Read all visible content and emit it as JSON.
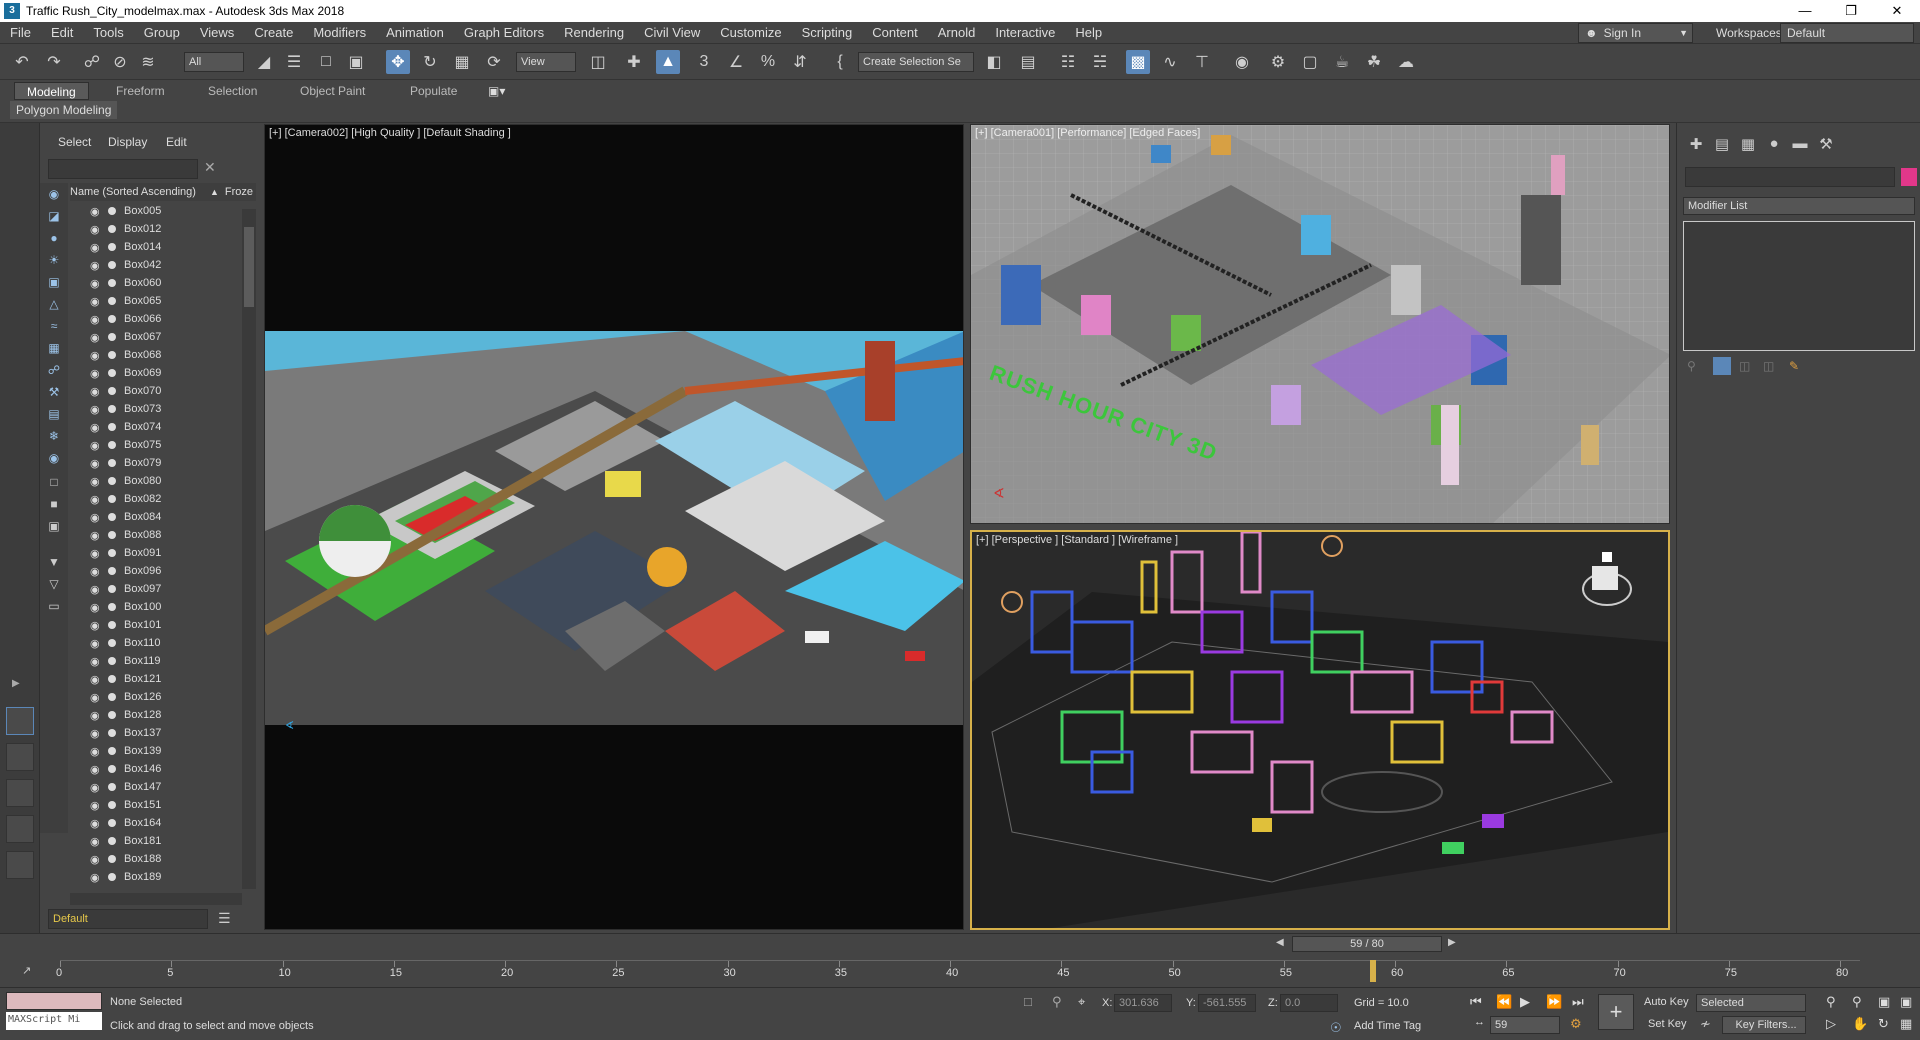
{
  "window": {
    "title": "Traffic Rush_City_modelmax.max - Autodesk 3ds Max 2018"
  },
  "menu": [
    "File",
    "Edit",
    "Tools",
    "Group",
    "Views",
    "Create",
    "Modifiers",
    "Animation",
    "Graph Editors",
    "Rendering",
    "Civil View",
    "Customize",
    "Scripting",
    "Content",
    "Arnold",
    "Interactive",
    "Help"
  ],
  "account": {
    "signin": "Sign In",
    "workspaces_label": "Workspaces:",
    "workspace": "Default"
  },
  "toolbar": {
    "filter": "All",
    "refcoord": "View",
    "selection_set": "Create Selection Se"
  },
  "ribbon": {
    "tabs": [
      "Modeling",
      "Freeform",
      "Selection",
      "Object Paint",
      "Populate"
    ],
    "active": "Modeling",
    "subtab": "Polygon Modeling"
  },
  "explorer": {
    "tabs": [
      "Select",
      "Display",
      "Edit"
    ],
    "header_name": "Name (Sorted Ascending)",
    "header_frozen": "Froze",
    "items": [
      "Box005",
      "Box012",
      "Box014",
      "Box042",
      "Box060",
      "Box065",
      "Box066",
      "Box067",
      "Box068",
      "Box069",
      "Box070",
      "Box073",
      "Box074",
      "Box075",
      "Box079",
      "Box080",
      "Box082",
      "Box084",
      "Box088",
      "Box091",
      "Box096",
      "Box097",
      "Box100",
      "Box101",
      "Box110",
      "Box119",
      "Box121",
      "Box126",
      "Box128",
      "Box137",
      "Box139",
      "Box146",
      "Box147",
      "Box151",
      "Box164",
      "Box181",
      "Box188",
      "Box189"
    ],
    "layer": "Default"
  },
  "viewports": {
    "vp1": "[+] [Camera002] [High Quality ] [Default Shading ]",
    "vp2": "[+] [Camera001] [Performance] [Edged Faces]",
    "vp3": "[+] [Perspective ] [Standard ] [Wireframe ]",
    "vp2_text": "RUSH HOUR CITY 3D"
  },
  "command_panel": {
    "modifier_list": "Modifier List"
  },
  "timeline": {
    "frame": "59 / 80",
    "ticks": [
      0,
      5,
      10,
      15,
      20,
      25,
      30,
      35,
      40,
      45,
      50,
      55,
      60,
      65,
      70,
      75,
      80
    ],
    "current": 59,
    "total": 80
  },
  "status": {
    "maxscript": "MAXScript Mi",
    "selection": "None Selected",
    "prompt": "Click and drag to select and move objects",
    "x_label": "X:",
    "x": "301.636",
    "y_label": "Y:",
    "y": "-561.555",
    "z_label": "Z:",
    "z": "0.0",
    "grid": "Grid = 10.0",
    "add_time_tag": "Add Time Tag",
    "auto_key": "Auto Key",
    "set_key": "Set Key",
    "selected": "Selected",
    "key_filters": "Key Filters...",
    "frame_spinner": "59"
  }
}
